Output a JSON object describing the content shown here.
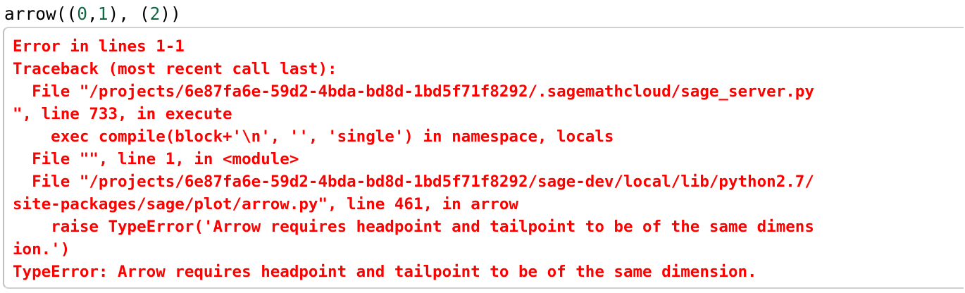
{
  "input": {
    "prefix": "arrow((",
    "arg1": "0",
    "sep1": ",",
    "arg2": "1",
    "sep2": "), (",
    "arg3": "2",
    "suffix": "))"
  },
  "output": {
    "colors": {
      "error": "#ff0000",
      "number": "#116644"
    },
    "lines": [
      "Error in lines 1-1",
      "Traceback (most recent call last):",
      "  File \"/projects/6e87fa6e-59d2-4bda-bd8d-1bd5f71f8292/.sagemathcloud/sage_server.py",
      "\", line 733, in execute",
      "    exec compile(block+'\\n', '', 'single') in namespace, locals",
      "  File \"\", line 1, in <module>",
      "  File \"/projects/6e87fa6e-59d2-4bda-bd8d-1bd5f71f8292/sage-dev/local/lib/python2.7/",
      "site-packages/sage/plot/arrow.py\", line 461, in arrow",
      "    raise TypeError('Arrow requires headpoint and tailpoint to be of the same dimens",
      "ion.')",
      "TypeError: Arrow requires headpoint and tailpoint to be of the same dimension."
    ]
  }
}
